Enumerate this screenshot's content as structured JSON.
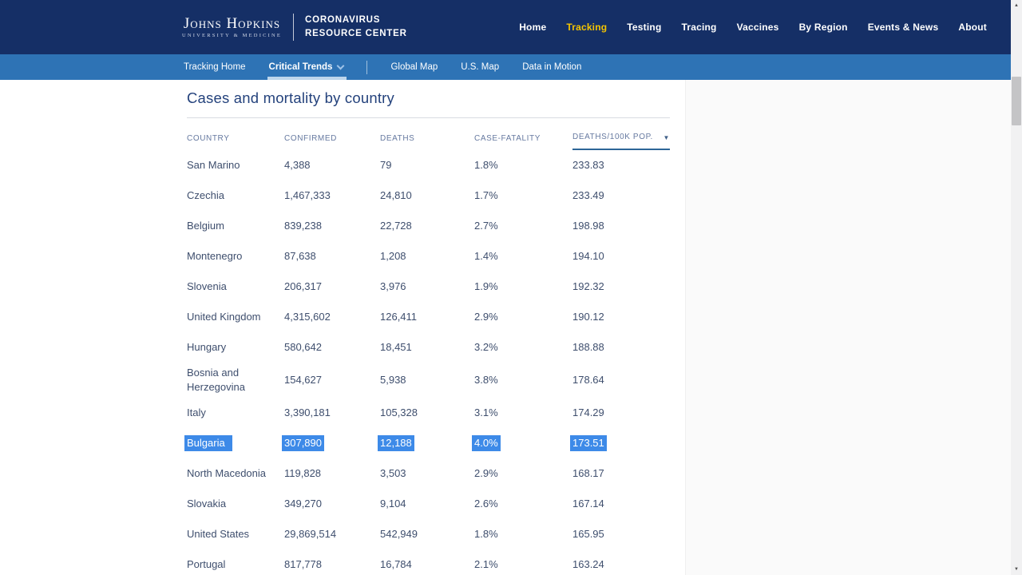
{
  "brand": {
    "institution": "Johns Hopkins",
    "institution_sub": "UNIVERSITY & MEDICINE",
    "site_line1": "CORONAVIRUS",
    "site_line2": "RESOURCE CENTER"
  },
  "nav": {
    "items": [
      {
        "label": "Home",
        "active": false
      },
      {
        "label": "Tracking",
        "active": true
      },
      {
        "label": "Testing",
        "active": false
      },
      {
        "label": "Tracing",
        "active": false
      },
      {
        "label": "Vaccines",
        "active": false
      },
      {
        "label": "By Region",
        "active": false
      },
      {
        "label": "Events & News",
        "active": false
      },
      {
        "label": "About",
        "active": false
      }
    ]
  },
  "subnav": {
    "items": [
      {
        "label": "Tracking Home",
        "active": false
      },
      {
        "label": "Critical Trends",
        "active": true,
        "chevron": true
      },
      {
        "divider": true
      },
      {
        "label": "Global Map",
        "active": false
      },
      {
        "label": "U.S. Map",
        "active": false
      },
      {
        "label": "Data in Motion",
        "active": false
      }
    ]
  },
  "main": {
    "title": "Cases and mortality by country",
    "table": {
      "columns": [
        "COUNTRY",
        "CONFIRMED",
        "DEATHS",
        "CASE-FATALITY",
        "DEATHS/100K POP."
      ],
      "sorted_column_index": 4,
      "sort_icon": "▼",
      "rows": [
        {
          "country": "San Marino",
          "confirmed": "4,388",
          "deaths": "79",
          "case_fatality": "1.8%",
          "deaths_100k": "233.83",
          "selected": false
        },
        {
          "country": "Czechia",
          "confirmed": "1,467,333",
          "deaths": "24,810",
          "case_fatality": "1.7%",
          "deaths_100k": "233.49",
          "selected": false
        },
        {
          "country": "Belgium",
          "confirmed": "839,238",
          "deaths": "22,728",
          "case_fatality": "2.7%",
          "deaths_100k": "198.98",
          "selected": false
        },
        {
          "country": "Montenegro",
          "confirmed": "87,638",
          "deaths": "1,208",
          "case_fatality": "1.4%",
          "deaths_100k": "194.10",
          "selected": false
        },
        {
          "country": "Slovenia",
          "confirmed": "206,317",
          "deaths": "3,976",
          "case_fatality": "1.9%",
          "deaths_100k": "192.32",
          "selected": false
        },
        {
          "country": "United Kingdom",
          "confirmed": "4,315,602",
          "deaths": "126,411",
          "case_fatality": "2.9%",
          "deaths_100k": "190.12",
          "selected": false
        },
        {
          "country": "Hungary",
          "confirmed": "580,642",
          "deaths": "18,451",
          "case_fatality": "3.2%",
          "deaths_100k": "188.88",
          "selected": false
        },
        {
          "country": "Bosnia and Herzegovina",
          "confirmed": "154,627",
          "deaths": "5,938",
          "case_fatality": "3.8%",
          "deaths_100k": "178.64",
          "selected": false
        },
        {
          "country": "Italy",
          "confirmed": "3,390,181",
          "deaths": "105,328",
          "case_fatality": "3.1%",
          "deaths_100k": "174.29",
          "selected": false
        },
        {
          "country": "Bulgaria",
          "confirmed": "307,890",
          "deaths": "12,188",
          "case_fatality": "4.0%",
          "deaths_100k": "173.51",
          "selected": true
        },
        {
          "country": "North Macedonia",
          "confirmed": "119,828",
          "deaths": "3,503",
          "case_fatality": "2.9%",
          "deaths_100k": "168.17",
          "selected": false
        },
        {
          "country": "Slovakia",
          "confirmed": "349,270",
          "deaths": "9,104",
          "case_fatality": "2.6%",
          "deaths_100k": "167.14",
          "selected": false
        },
        {
          "country": "United States",
          "confirmed": "29,869,514",
          "deaths": "542,949",
          "case_fatality": "1.8%",
          "deaths_100k": "165.95",
          "selected": false
        },
        {
          "country": "Portugal",
          "confirmed": "817,778",
          "deaths": "16,784",
          "case_fatality": "2.1%",
          "deaths_100k": "163.24",
          "selected": false
        }
      ]
    }
  },
  "scrollbar": {
    "up_icon": "▲",
    "down_icon": "▼"
  },
  "colors": {
    "header_bg": "#152f66",
    "subnav_bg": "#2e73b5",
    "gold": "#f5c400",
    "title_color": "#24427c",
    "cell_color": "#3e4e6d",
    "muted": "#6679a0",
    "selection": "#3d8ae8",
    "sort_underline": "#2d6697"
  }
}
